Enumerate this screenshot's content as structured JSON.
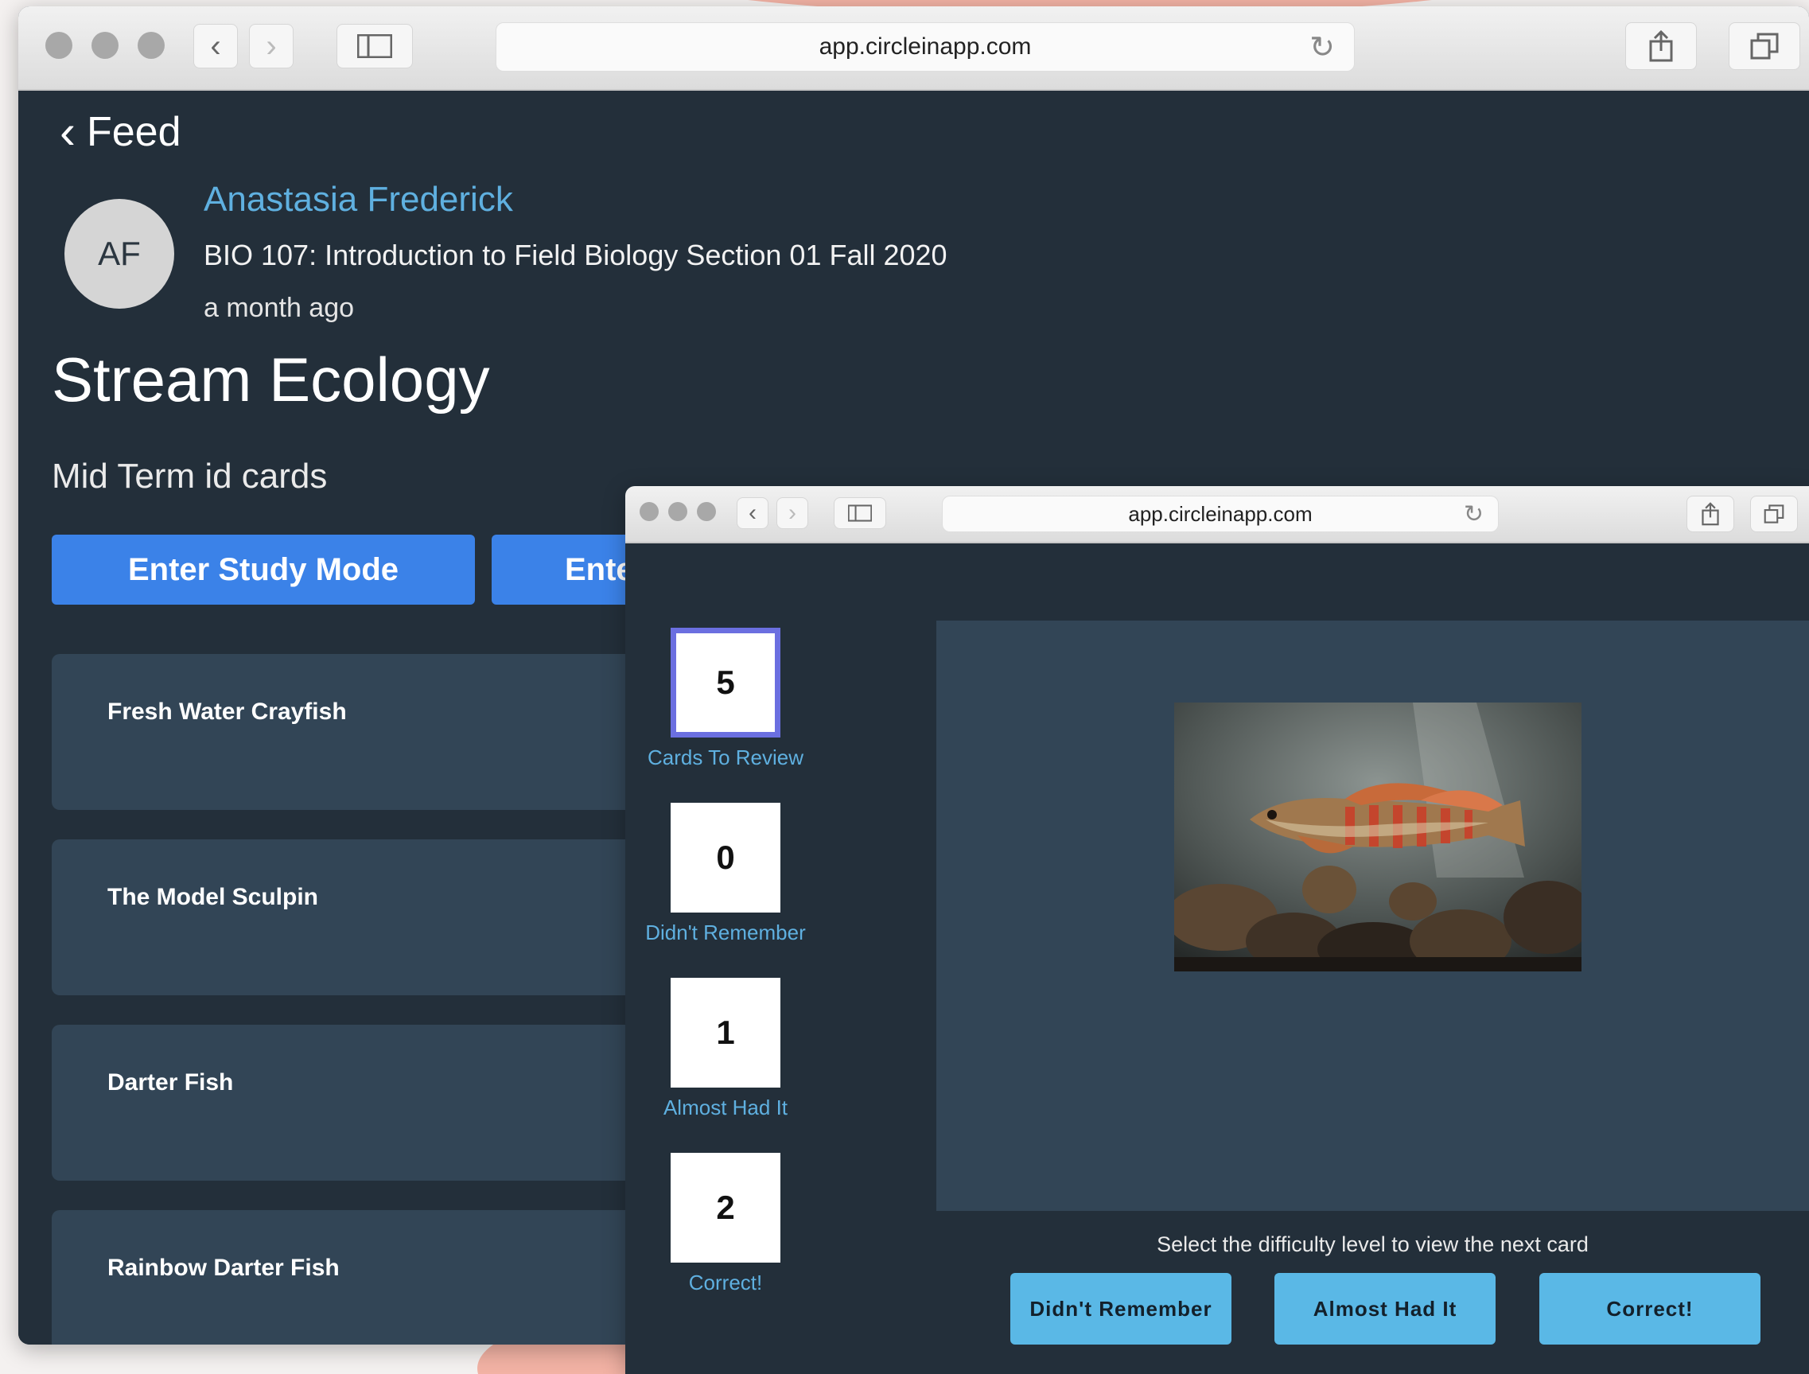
{
  "browser_back": {
    "url": "app.circleinapp.com"
  },
  "post": {
    "back_label": "Feed",
    "avatar_initials": "AF",
    "author": "Anastasia Frederick",
    "course": "BIO 107: Introduction to Field Biology Section 01 Fall 2020",
    "time": "a month ago",
    "title": "Stream Ecology",
    "subtitle": "Mid Term id cards",
    "study_button": "Enter Study Mode",
    "second_button": "Ente",
    "cards": [
      {
        "label": "Fresh Water Crayfish"
      },
      {
        "label": "The Model Sculpin"
      },
      {
        "label": "Darter Fish"
      },
      {
        "label": "Rainbow Darter Fish"
      }
    ]
  },
  "browser_front": {
    "url": "app.circleinapp.com"
  },
  "study": {
    "counters": [
      {
        "value": "5",
        "label": "Cards To Review"
      },
      {
        "value": "0",
        "label": "Didn't Remember"
      },
      {
        "value": "1",
        "label": "Almost Had It"
      },
      {
        "value": "2",
        "label": "Correct!"
      }
    ],
    "hint": "Select the difficulty level to view the next card",
    "buttons": {
      "didnt": "Didn't Remember",
      "almost": "Almost Had It",
      "correct": "Correct!"
    }
  },
  "colors": {
    "bg": "#232f3a",
    "card": "#324556",
    "accent_blue": "#3b82e8",
    "accent_cyan": "#5ab8e6",
    "link": "#5fb0e0",
    "active_border": "#6b6fe0"
  }
}
